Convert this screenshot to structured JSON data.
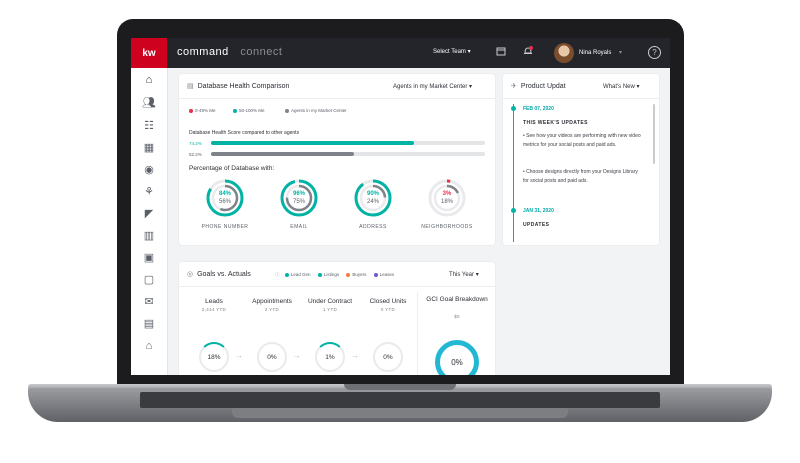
{
  "topbar": {
    "logo": "kw",
    "brand_primary": "command",
    "brand_secondary": "connect",
    "select_team": "Select Team ▾",
    "user_name": "Nina Royals",
    "help": "?"
  },
  "db_health": {
    "title": "Database Health Comparison",
    "dropdown": "Agents in my Market Center",
    "legend": [
      "0-49% Me",
      "50-100% Me",
      "Agents in my Market Center"
    ],
    "score_title": "Database Health Score compared to other agents",
    "bar1_label": "74.2%",
    "bar1_value": 74.2,
    "bar2_label": "52.2%",
    "bar2_value": 52.2,
    "percentage_title": "Percentage of Database with:",
    "rings": [
      {
        "label": "PHONE NUMBER",
        "me": "84%",
        "others": "56%",
        "me_value": 84,
        "others_value": 56,
        "color": "#00b3a4"
      },
      {
        "label": "EMAIL",
        "me": "96%",
        "others": "75%",
        "me_value": 96,
        "others_value": 75,
        "color": "#00b3a4"
      },
      {
        "label": "ADDRESS",
        "me": "90%",
        "others": "24%",
        "me_value": 90,
        "others_value": 24,
        "color": "#00b3a4"
      },
      {
        "label": "NEIGHBORHOODS",
        "me": "3%",
        "others": "18%",
        "me_value": 3,
        "others_value": 18,
        "color": "#e8304a"
      }
    ]
  },
  "goals": {
    "title": "Goals vs. Actuals",
    "legend": [
      "Lead Gen",
      "Listings",
      "Buyers",
      "Leases"
    ],
    "dropdown": "This Year",
    "columns": [
      {
        "head": "Leads",
        "sub": "2,414 YTD",
        "pct": "18%",
        "value": 18
      },
      {
        "head": "Appointments",
        "sub": "2 YTD",
        "pct": "0%",
        "value": 0
      },
      {
        "head": "Under Contract",
        "sub": "1 YTD",
        "pct": "1%",
        "value": 1
      },
      {
        "head": "Closed Units",
        "sub": "0 YTD",
        "pct": "0%",
        "value": 0
      }
    ],
    "gci_title": "GCI Goal Breakdown",
    "gci_sub": "$0",
    "gci_pct": "0%"
  },
  "updates": {
    "title": "Product Updat",
    "dropdown": "What's New",
    "entries": [
      {
        "date": "FEB 07, 2020",
        "heading": "THIS WEEK'S UPDATES",
        "items": [
          "See how your videos are performing with new video metrics for your social posts and paid ads.",
          "Choose designs directly from your Designs Library for social posts and paid ads."
        ]
      },
      {
        "date": "JAN 31, 2020",
        "heading": "UPDATES"
      }
    ]
  },
  "colors": {
    "accent_teal": "#00b3a4",
    "brand_red": "#ce011f",
    "gray_bar": "#7f8389",
    "low_red": "#e8304a"
  }
}
